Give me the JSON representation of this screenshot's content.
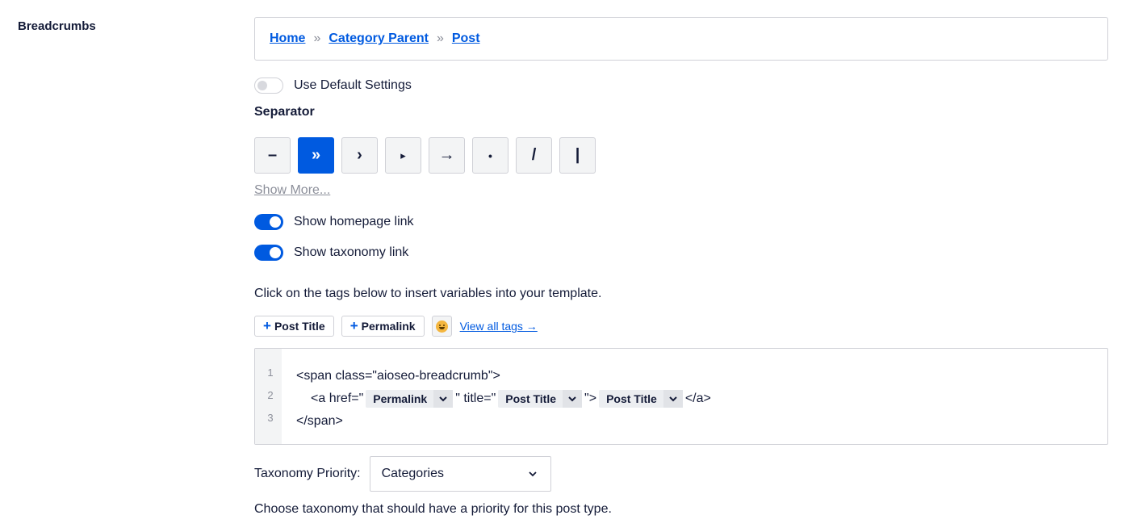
{
  "section": {
    "label": "Breadcrumbs"
  },
  "preview": {
    "crumbs": [
      "Home",
      "Category Parent",
      "Post"
    ],
    "separator": "»"
  },
  "default_settings": {
    "label": "Use Default Settings",
    "enabled": false
  },
  "separator": {
    "title": "Separator",
    "options": [
      "–",
      "»",
      "›",
      "▸",
      "→",
      "•",
      "/",
      "|"
    ],
    "selected": "»",
    "show_more": "Show More..."
  },
  "toggles": {
    "homepage": {
      "label": "Show homepage link",
      "enabled": true
    },
    "taxonomy": {
      "label": "Show taxonomy link",
      "enabled": true
    }
  },
  "tags": {
    "hint": "Click on the tags below to insert variables into your template.",
    "post_title": "Post Title",
    "permalink": "Permalink",
    "emoji_icon": "smiley-icon",
    "view_all": "View all tags →"
  },
  "editor": {
    "line_numbers": [
      "1",
      "2",
      "3"
    ],
    "line1": "<span class=\"aioseo-breadcrumb\">",
    "line2_a": "<a href=\"",
    "line2_b": "\" title=\"",
    "line2_c": "\">",
    "line2_d": "</a>",
    "line3": "</span>",
    "pill_permalink": "Permalink",
    "pill_post_title_1": "Post Title",
    "pill_post_title_2": "Post Title"
  },
  "priority": {
    "label": "Taxonomy Priority:",
    "value": "Categories",
    "description": "Choose taxonomy that should have a priority for this post type."
  },
  "colors": {
    "accent": "#005ae0",
    "border": "#d0d1d7",
    "text": "#141b38",
    "muted": "#8c8f9a"
  }
}
